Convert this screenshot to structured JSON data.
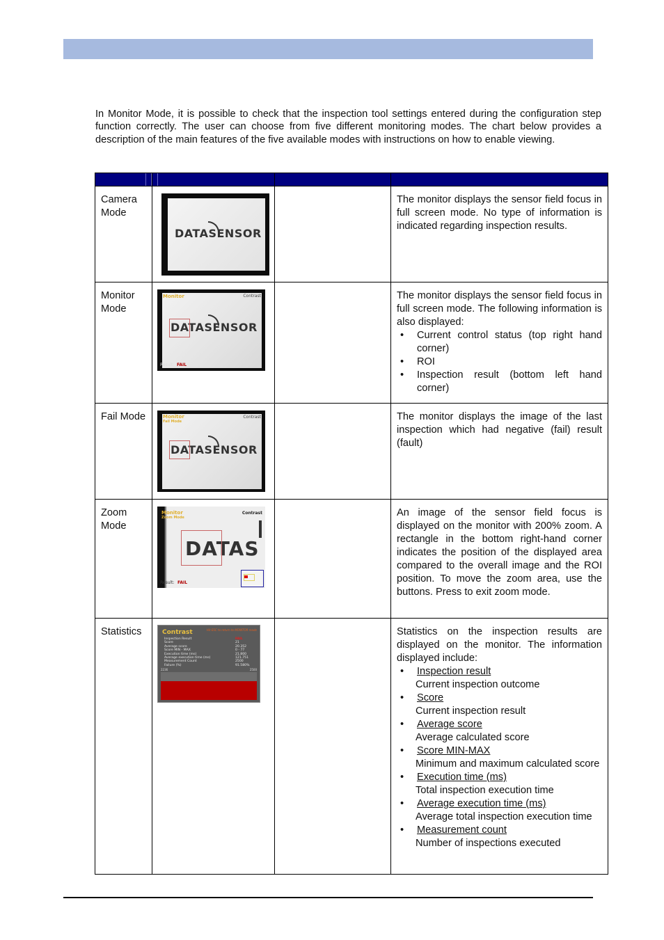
{
  "intro": "In Monitor Mode, it is possible to check that the inspection tool settings entered during the configuration step function correctly. The user can choose from five different monitoring modes. The chart below provides a description of the main features of the five available modes with instructions on how to enable viewing.",
  "table": {
    "header_color": "#000080",
    "rows": [
      {
        "mode": "Camera Mode",
        "image": {
          "logo": "DATASENSOR"
        },
        "description": "The monitor displays the sensor field focus in full screen mode. No type of information is indicated regarding inspection results."
      },
      {
        "mode": "Monitor Mode",
        "image": {
          "logo": "DATASENSOR",
          "overlay_title": "Monitor",
          "overlay_status": "Contrast",
          "overlay_result_label": "Result:",
          "overlay_result_value": "FAIL"
        },
        "description": "The monitor displays the sensor field focus in full screen mode. The following information is also displayed:",
        "bullets": [
          "Current control status (top right hand corner)",
          "ROI",
          "Inspection result (bottom left hand corner)"
        ]
      },
      {
        "mode": "Fail Mode",
        "image": {
          "logo": "DATASENSOR",
          "overlay_title": "Monitor",
          "overlay_subtitle": "Fail Mode",
          "overlay_status": "Contrast"
        },
        "description": "The monitor displays the image of the last inspection which had negative (fail) result (fault)"
      },
      {
        "mode": "Zoom Mode",
        "image": {
          "logo": "DATAS",
          "overlay_title": "Monitor",
          "overlay_subtitle": "Zoom Mode",
          "overlay_status": "Contrast",
          "overlay_result_label": "Result:",
          "overlay_result_value": "FAIL"
        },
        "description": "An image of the sensor field focus is displayed on the monitor with 200% zoom. A rectangle in the bottom right-hand corner indicates the position of the displayed area compared to the overall image and the ROI position. To move the zoom area, use the buttons. Press to exit zoom mode."
      },
      {
        "mode": "Statistics",
        "image": {
          "title": "Contrast",
          "hint": "Hit ESC to return to MONITOR mode",
          "rows": [
            {
              "label": "Inspection Result",
              "value": "FAIL"
            },
            {
              "label": "Score",
              "value": "21"
            },
            {
              "label": "Average score",
              "value": "20.352"
            },
            {
              "label": "Score MIN - MAX",
              "value": "0 - 77"
            },
            {
              "label": "Execution time (ms)",
              "value": "21.800"
            },
            {
              "label": "Average execution time (ms)",
              "value": "121.751"
            },
            {
              "label": "Measurement Count",
              "value": "2500"
            },
            {
              "label": "Failure (%)",
              "value": "91.580%"
            }
          ],
          "scale_left": "2236",
          "scale_right": "2500"
        },
        "description": "Statistics on the inspection results are displayed on the monitor. The information displayed include:",
        "items": [
          {
            "title": "Inspection result",
            "text": "Current inspection outcome"
          },
          {
            "title": "Score",
            "text": "Current inspection result"
          },
          {
            "title": "Average score",
            "text": "Average calculated score"
          },
          {
            "title": "Score MIN-MAX",
            "text": "Minimum and maximum calculated score"
          },
          {
            "title": "Execution time (ms)",
            "text": "Total inspection execution time"
          },
          {
            "title": "Average execution time (ms)",
            "text": "Average total inspection execution time"
          },
          {
            "title": "Measurement count",
            "text": "Number of inspections executed"
          }
        ]
      }
    ]
  }
}
